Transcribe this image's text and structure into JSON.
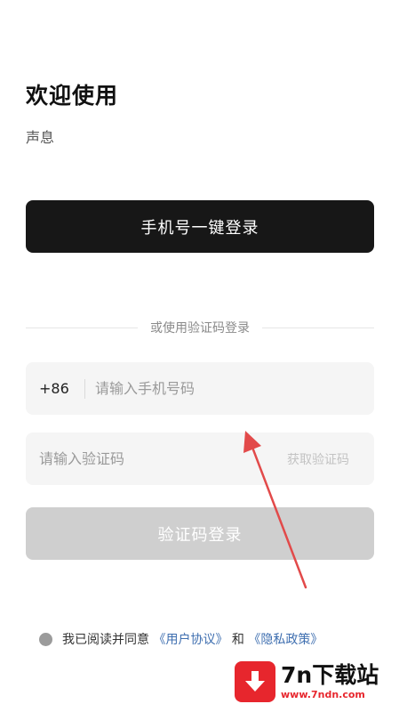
{
  "header": {
    "welcome": "欢迎使用",
    "app_name": "声息"
  },
  "one_click_login": {
    "label": "手机号一键登录"
  },
  "divider": {
    "text": "或使用验证码登录"
  },
  "phone": {
    "country_code": "+86",
    "placeholder": "请输入手机号码",
    "value": ""
  },
  "verification": {
    "placeholder": "请输入验证码",
    "value": "",
    "get_code_label": "获取验证码"
  },
  "code_login": {
    "label": "验证码登录"
  },
  "agreement": {
    "prefix": "我已阅读并同意",
    "user_agreement": "《用户协议》",
    "and": "和",
    "privacy_policy": "《隐私政策》"
  },
  "watermark": {
    "title": "7n下载站",
    "url": "www.7ndn.com"
  },
  "colors": {
    "primary_button": "#171717",
    "disabled_button": "#cfcfcf",
    "input_bg": "#f5f5f5",
    "link": "#3f6fb0",
    "annotation_arrow": "#e24a4a",
    "watermark_red": "#e7262d"
  }
}
